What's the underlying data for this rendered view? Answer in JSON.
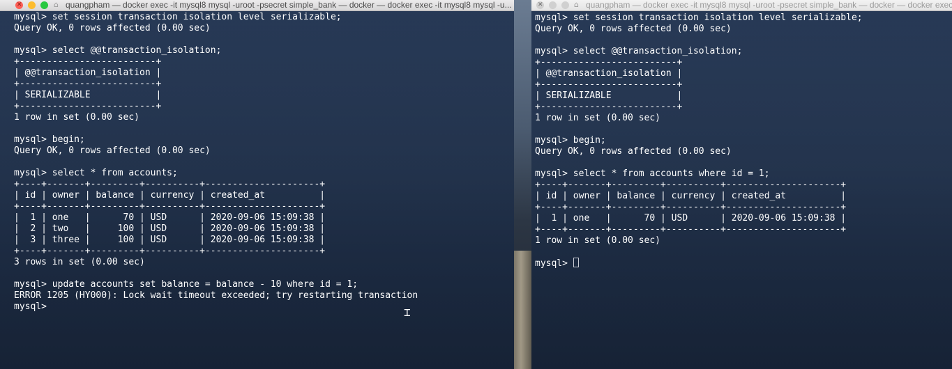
{
  "left_window": {
    "title": "quangpham — docker exec -it mysql8 mysql -uroot -psecret simple_bank — docker — docker exec -it mysql8 mysql -u...",
    "lines": [
      "mysql> set session transaction isolation level serializable;",
      "Query OK, 0 rows affected (0.00 sec)",
      "",
      "mysql> select @@transaction_isolation;",
      "+-------------------------+",
      "| @@transaction_isolation |",
      "+-------------------------+",
      "| SERIALIZABLE            |",
      "+-------------------------+",
      "1 row in set (0.00 sec)",
      "",
      "mysql> begin;",
      "Query OK, 0 rows affected (0.00 sec)",
      "",
      "mysql> select * from accounts;",
      "+----+-------+---------+----------+---------------------+",
      "| id | owner | balance | currency | created_at          |",
      "+----+-------+---------+----------+---------------------+",
      "|  1 | one   |      70 | USD      | 2020-09-06 15:09:38 |",
      "|  2 | two   |     100 | USD      | 2020-09-06 15:09:38 |",
      "|  3 | three |     100 | USD      | 2020-09-06 15:09:38 |",
      "+----+-------+---------+----------+---------------------+",
      "3 rows in set (0.00 sec)",
      "",
      "mysql> update accounts set balance = balance - 10 where id = 1;",
      "ERROR 1205 (HY000): Lock wait timeout exceeded; try restarting transaction",
      "mysql> "
    ]
  },
  "right_window": {
    "title": "quangpham — docker exec -it mysql8 mysql -uroot -psecret simple_bank — docker — docker exec -",
    "lines": [
      "mysql> set session transaction isolation level serializable;",
      "Query OK, 0 rows affected (0.00 sec)",
      "",
      "mysql> select @@transaction_isolation;",
      "+-------------------------+",
      "| @@transaction_isolation |",
      "+-------------------------+",
      "| SERIALIZABLE            |",
      "+-------------------------+",
      "1 row in set (0.00 sec)",
      "",
      "mysql> begin;",
      "Query OK, 0 rows affected (0.00 sec)",
      "",
      "mysql> select * from accounts where id = 1;",
      "+----+-------+---------+----------+---------------------+",
      "| id | owner | balance | currency | created_at          |",
      "+----+-------+---------+----------+---------------------+",
      "|  1 | one   |      70 | USD      | 2020-09-06 15:09:38 |",
      "+----+-------+---------+----------+---------------------+",
      "1 row in set (0.00 sec)",
      ""
    ],
    "prompt": "mysql> "
  },
  "icons": {
    "close": "close-icon",
    "minimize": "minimize-icon",
    "zoom": "zoom-icon",
    "home": "home-icon",
    "ibeam": "text-cursor-icon"
  },
  "colors": {
    "close": "#fc5f57",
    "minimize": "#fdbc2e",
    "zoom": "#28c840",
    "terminal_text": "#ffffff"
  }
}
